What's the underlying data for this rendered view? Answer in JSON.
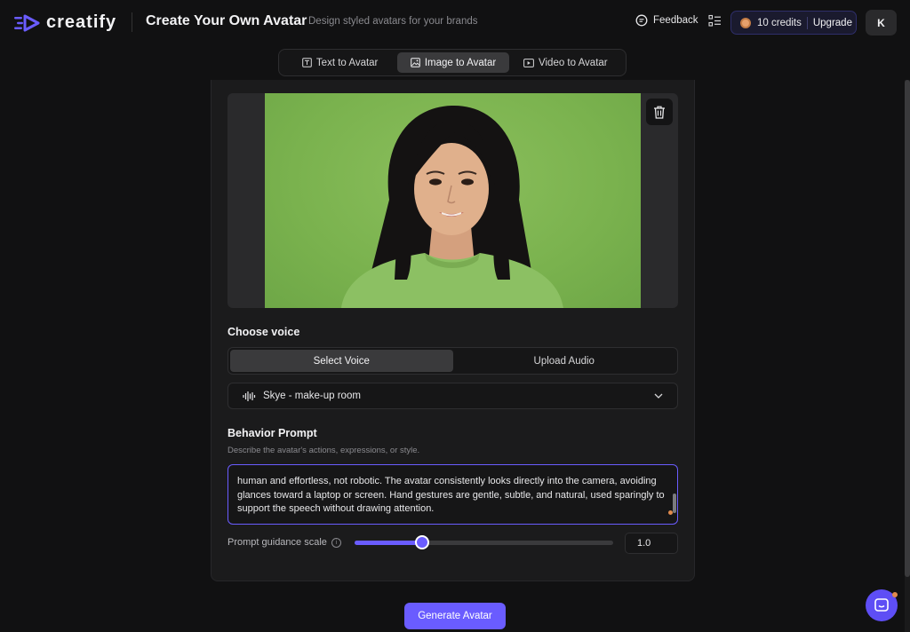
{
  "header": {
    "logo_text": "creatify",
    "title": "Create Your Own Avatar",
    "subtitle": "Design styled avatars for your brands",
    "feedback_label": "Feedback",
    "credits_label": "10 credits",
    "upgrade_label": "Upgrade",
    "user_initial": "K"
  },
  "tabs": [
    {
      "label": "Text to Avatar",
      "icon": "text-box-icon",
      "active": false
    },
    {
      "label": "Image to Avatar",
      "icon": "image-icon",
      "active": true
    },
    {
      "label": "Video to Avatar",
      "icon": "video-icon",
      "active": false
    }
  ],
  "voice": {
    "section_title": "Choose voice",
    "toggle": [
      "Select Voice",
      "Upload Audio"
    ],
    "active_toggle": "Select Voice",
    "selected_voice": "Skye - make-up room"
  },
  "behavior": {
    "section_title": "Behavior Prompt",
    "hint": "Describe the avatar's actions, expressions, or style.",
    "prompt_text": "human and effortless, not robotic. The avatar consistently looks directly into the camera, avoiding glances toward a laptop or screen. Hand gestures are gentle, subtle, and natural, used sparingly to support the speech without drawing attention."
  },
  "guidance": {
    "label": "Prompt guidance scale",
    "value": "1.0",
    "slider_fraction": 0.26
  },
  "generate_label": "Generate Avatar",
  "colors": {
    "accent": "#6a5cff",
    "background": "#111112",
    "image_bg_green": "#7ab24e"
  }
}
